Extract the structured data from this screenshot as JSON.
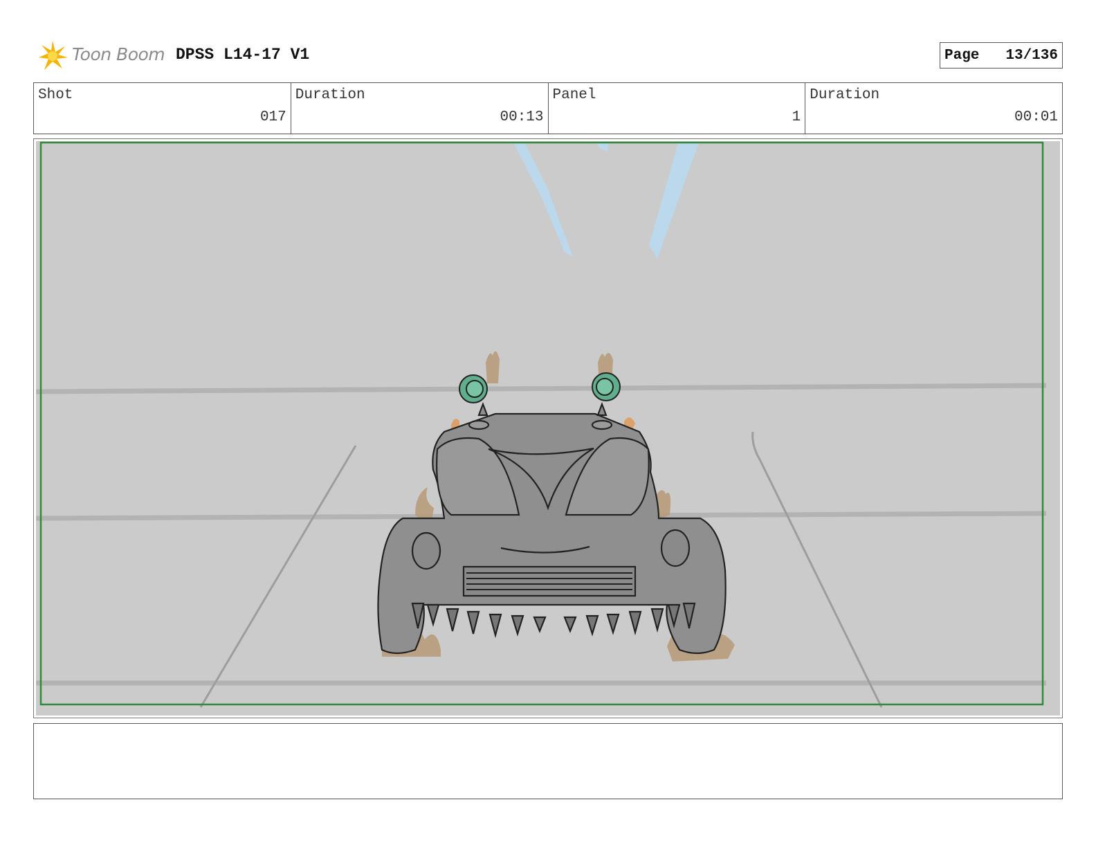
{
  "header": {
    "logo_text": "Toon Boom",
    "project_title": "DPSS L14-17 V1",
    "page_label": "Page",
    "page_number": "13/136"
  },
  "info": {
    "shot_label": "Shot",
    "shot_value": "017",
    "shot_duration_label": "Duration",
    "shot_duration_value": "00:13",
    "panel_label": "Panel",
    "panel_value": "1",
    "panel_duration_label": "Duration",
    "panel_duration_value": "00:01"
  },
  "panel": {
    "background_color": "#cbcbcb",
    "safe_frame_color": "#2f8a3a",
    "car_color": "#8f8f8f",
    "headlight_color": "#5fae8c",
    "flame_color": "#b89a78",
    "light_beam_color": "#bcd8ec"
  },
  "notes": {
    "text": ""
  }
}
